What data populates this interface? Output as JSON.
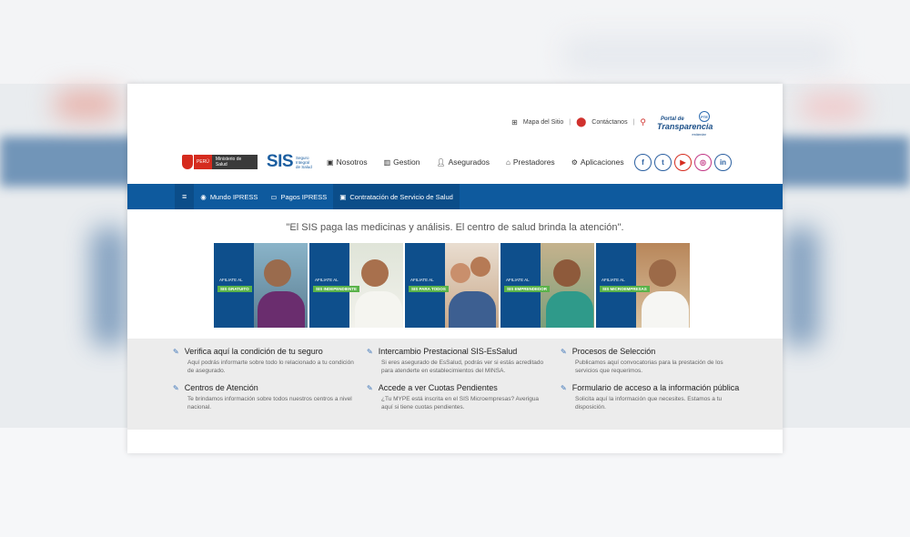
{
  "top_links": {
    "sitemap": "Mapa del Sitio",
    "contact": "Contáctanos",
    "separator": "|"
  },
  "transparency": {
    "line1": "Portal de",
    "line2": "Transparencia",
    "line3": "estándar",
    "badge": "PTE"
  },
  "brand": {
    "peru": "PERÚ",
    "ministry": "Ministerio de Salud",
    "sis": "SIS",
    "sis_sub": "Seguro Integral de Salud"
  },
  "main_nav": [
    {
      "label": "Nosotros",
      "icon": "info-icon"
    },
    {
      "label": "Gestion",
      "icon": "building-icon"
    },
    {
      "label": "Asegurados",
      "icon": "user-icon"
    },
    {
      "label": "Prestadores",
      "icon": "hospital-icon"
    },
    {
      "label": "Aplicaciones",
      "icon": "gear-icon"
    }
  ],
  "social": [
    "f",
    "t",
    "▶",
    "◎",
    "in"
  ],
  "blue_bar": {
    "items": [
      {
        "label": "Mundo IPRESS"
      },
      {
        "label": "Pagos IPRESS"
      },
      {
        "label": "Contratación de Servicio de Salud"
      }
    ]
  },
  "slogan": "\"El SIS paga las medicinas y análisis. El centro de salud brinda la atención\".",
  "cards": [
    {
      "tag1": "AFILIATE AL",
      "tag2": "SIS GRATUITO"
    },
    {
      "tag1": "AFILIATE AL",
      "tag2": "SIS INDEPENDIENTE"
    },
    {
      "tag1": "AFILIATE AL",
      "tag2": "SIS PARA TODOS"
    },
    {
      "tag1": "AFILIATE AL",
      "tag2": "SIS EMPRENDEDOR"
    },
    {
      "tag1": "AFILIATE AL",
      "tag2": "SIS MICROEMPRESAS"
    }
  ],
  "info_columns": [
    [
      {
        "title": "Verifica aquí la condición de tu seguro",
        "desc": "Aquí podrás informarte sobre todo lo relacionado a tu condición de asegurado."
      },
      {
        "title": "Centros de Atención",
        "desc": "Te brindamos información sobre todos nuestros centros a nivel nacional."
      }
    ],
    [
      {
        "title": "Intercambio Prestacional SIS-EsSalud",
        "desc": "Si eres asegurado de EsSalud, podrás ver si estás acreditado para atenderte en establecimientos del MINSA."
      },
      {
        "title": "Accede a ver Cuotas Pendientes",
        "desc": "¿Tu MYPE está inscrita en el SIS Microempresas? Averigua aquí si tiene cuotas pendientes."
      }
    ],
    [
      {
        "title": "Procesos de Selección",
        "desc": "Publicamos aquí convocatorias para la prestación de los servicios que requerimos."
      },
      {
        "title": "Formulario de acceso a la información pública",
        "desc": "Solicita aquí la información que necesites. Estamos a tu disposición."
      }
    ]
  ]
}
